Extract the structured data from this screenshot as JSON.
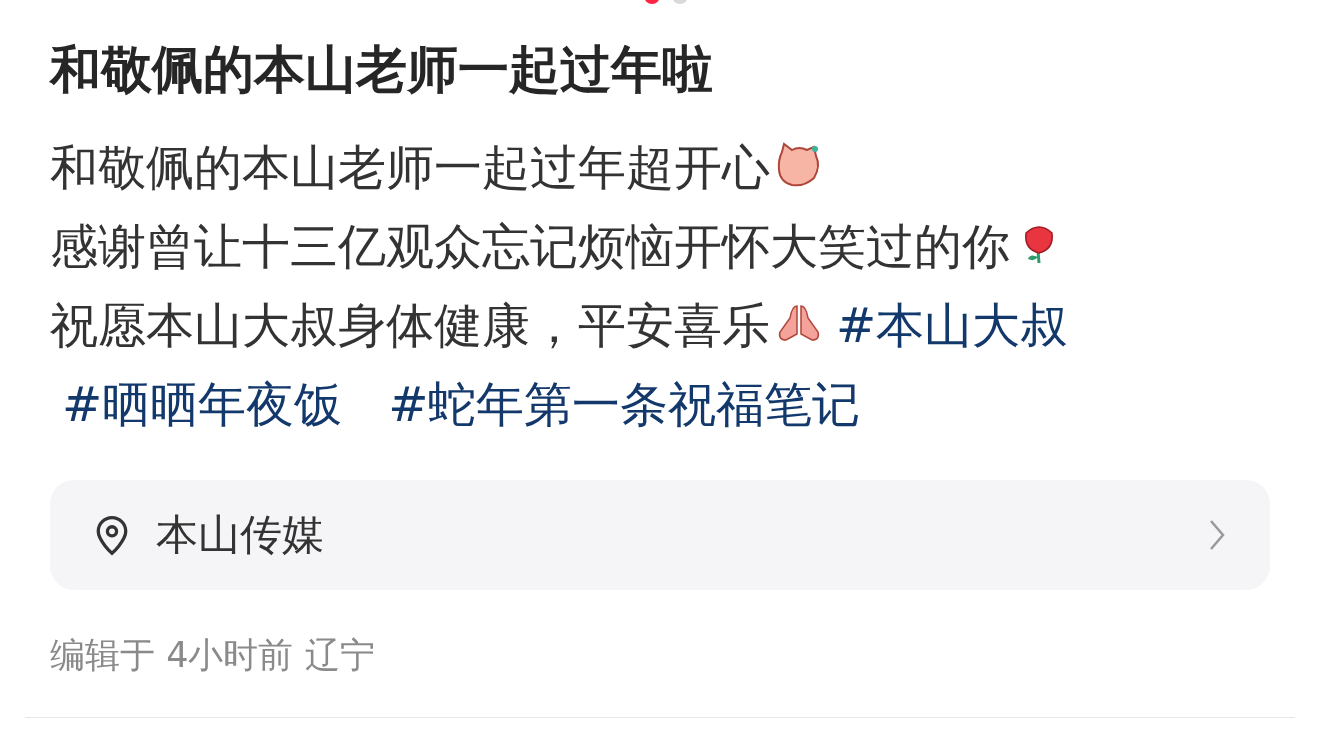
{
  "pager": [
    {
      "selected": true
    },
    {
      "selected": false
    }
  ],
  "title": "和敬佩的本山老师一起过年啦",
  "body": [
    {
      "segments": [
        {
          "kind": "text",
          "text": "和敬佩的本山老师一起过年超开心"
        },
        {
          "kind": "sticker"
        }
      ]
    },
    {
      "segments": [
        {
          "kind": "text",
          "text": "感谢曾让十三亿观众忘记烦恼开怀大笑过的你"
        },
        {
          "kind": "rose"
        }
      ]
    },
    {
      "segments": [
        {
          "kind": "text",
          "text": "祝愿本山大叔身体健康，平安喜乐"
        },
        {
          "kind": "hands"
        },
        {
          "kind": "hashtag",
          "text": "#本山大叔"
        },
        {
          "kind": "hashtag",
          "text": "#晒晒年夜饭"
        },
        {
          "kind": "hashtag",
          "text": "#蛇年第一条祝福笔记"
        }
      ]
    }
  ],
  "location": {
    "name": "本山传媒"
  },
  "footer": "编辑于 4小时前 辽宁"
}
